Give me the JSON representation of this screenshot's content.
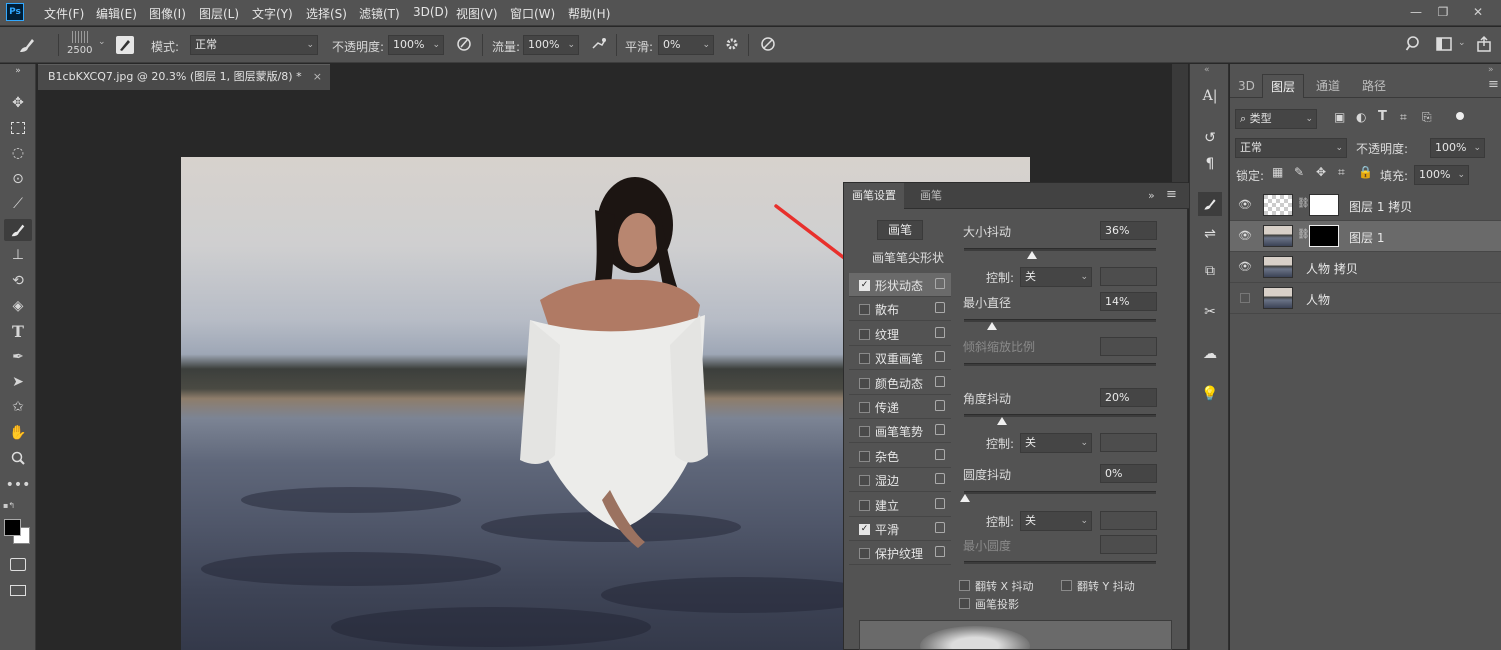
{
  "menubar": {
    "logo": "Ps",
    "items": [
      "文件(F)",
      "编辑(E)",
      "图像(I)",
      "图层(L)",
      "文字(Y)",
      "选择(S)",
      "滤镜(T)",
      "3D(D)",
      "视图(V)",
      "窗口(W)",
      "帮助(H)"
    ],
    "minimize": "—",
    "restore": "❐",
    "close": "✕"
  },
  "options": {
    "brush_size": "2500",
    "mode_label": "模式:",
    "mode_value": "正常",
    "opacity_label": "不透明度:",
    "opacity_value": "100%",
    "flow_label": "流量:",
    "flow_value": "100%",
    "smooth_label": "平滑:",
    "smooth_value": "0%"
  },
  "document": {
    "tab_title": "B1cbKXCQ7.jpg @ 20.3% (图层 1, 图层蒙版/8) *",
    "close": "×"
  },
  "brush_panel": {
    "tabs": [
      "画笔设置",
      "画笔"
    ],
    "brush_button": "画笔",
    "tip_shape": "画笔笔尖形状",
    "options": [
      {
        "label": "形状动态",
        "checked": true
      },
      {
        "label": "散布",
        "checked": false
      },
      {
        "label": "纹理",
        "checked": false
      },
      {
        "label": "双重画笔",
        "checked": false
      },
      {
        "label": "颜色动态",
        "checked": false
      },
      {
        "label": "传递",
        "checked": false
      },
      {
        "label": "画笔笔势",
        "checked": false
      },
      {
        "label": "杂色",
        "checked": false
      },
      {
        "label": "湿边",
        "checked": false
      },
      {
        "label": "建立",
        "checked": false
      },
      {
        "label": "平滑",
        "checked": true
      },
      {
        "label": "保护纹理",
        "checked": false
      }
    ],
    "size_jitter_label": "大小抖动",
    "size_jitter_value": "36%",
    "control_label": "控制:",
    "control_value": "关",
    "min_diameter_label": "最小直径",
    "min_diameter_value": "14%",
    "tilt_scale_label": "倾斜缩放比例",
    "angle_jitter_label": "角度抖动",
    "angle_jitter_value": "20%",
    "roundness_jitter_label": "圆度抖动",
    "roundness_jitter_value": "0%",
    "min_roundness_label": "最小圆度",
    "flip_x_label": "翻转 X 抖动",
    "flip_y_label": "翻转 Y 抖动",
    "projection_label": "画笔投影"
  },
  "layers_panel": {
    "tabs": [
      "3D",
      "图层",
      "通道",
      "路径"
    ],
    "filter_label": "类型",
    "blend_mode": "正常",
    "opacity_label": "不透明度:",
    "opacity_value": "100%",
    "lock_label": "锁定:",
    "fill_label": "填充:",
    "fill_value": "100%",
    "layers": [
      {
        "name": "图层 1 拷贝",
        "visible": true,
        "selected": false
      },
      {
        "name": "图层 1",
        "visible": true,
        "selected": true
      },
      {
        "name": "人物 拷贝",
        "visible": true,
        "selected": false
      },
      {
        "name": "人物",
        "visible": false,
        "selected": false
      }
    ]
  },
  "colors": {
    "accent": "#31a8ff",
    "annotation_arrow": "#e8302c"
  }
}
